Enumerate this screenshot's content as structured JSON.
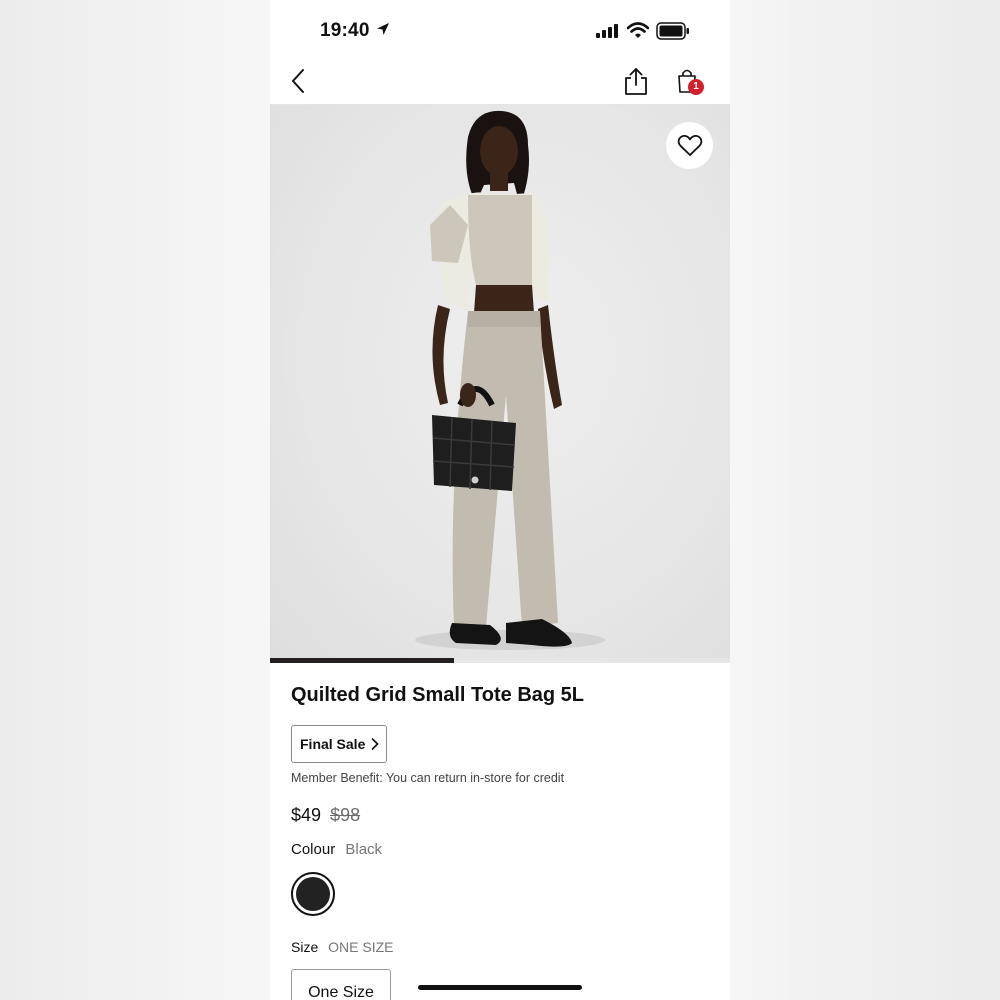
{
  "status_bar": {
    "time": "19:40"
  },
  "nav": {
    "cart_count": "1"
  },
  "gallery": {
    "progress_fraction": 0.4
  },
  "product": {
    "title": "Quilted Grid Small Tote Bag 5L",
    "final_sale_label": "Final Sale",
    "member_benefit": "Member Benefit: You can return in-store for credit",
    "price": "$49",
    "original_price": "$98",
    "colour_label": "Colour",
    "colour_value": "Black",
    "swatch_color": "#222222",
    "size_label": "Size",
    "size_value": "ONE SIZE",
    "size_option": "One Size"
  },
  "colors": {
    "badge": "#d4202c",
    "progress": "#231f20"
  }
}
